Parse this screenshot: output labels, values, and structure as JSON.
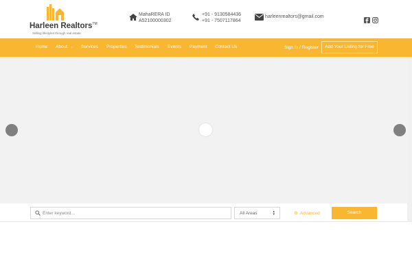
{
  "brand": {
    "name": "Harleen Realtors",
    "trademark": "TM",
    "tagline": "Selling lifestyles through real estate",
    "colors": {
      "accent": "#f9b731",
      "logo_dark": "#3b3b3b"
    }
  },
  "header": {
    "rera": {
      "icon": "home-icon",
      "line1": "MahaRERA ID",
      "line2": "A52100000302"
    },
    "phone": {
      "icon": "phone-icon",
      "line1": "+91 - 9130584436",
      "line2": "+91 - 7507117864"
    },
    "email": {
      "icon": "envelope-icon",
      "text": "harleenrealtors@gmail.com"
    },
    "social": [
      "facebook-icon",
      "instagram-icon"
    ]
  },
  "nav": {
    "items": [
      {
        "label": "Home"
      },
      {
        "label": "About"
      },
      {
        "label": "Services"
      },
      {
        "label": "Properties"
      },
      {
        "label": "Testimonials"
      },
      {
        "label": "Events"
      },
      {
        "label": "Payment"
      },
      {
        "label": "Contact Us"
      }
    ],
    "signin_label": "Sign In / Register",
    "listing_button": "Add Your Listing for Free"
  },
  "search": {
    "keyword_placeholder": "Enter keyword...",
    "area_selected": "All Areas",
    "advanced_label": "Advanced",
    "button_label": "Search"
  }
}
